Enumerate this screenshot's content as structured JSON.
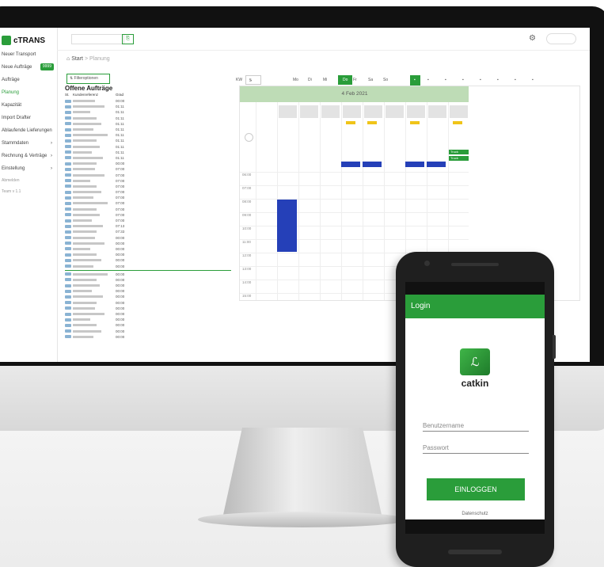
{
  "brand": {
    "name": "cTRANS"
  },
  "sidebar": {
    "items": [
      {
        "label": "Neuer Transport"
      },
      {
        "label": "Neue Aufträge",
        "badge": "9999"
      },
      {
        "label": "Aufträge"
      },
      {
        "label": "Planung"
      },
      {
        "label": "Kapazität"
      },
      {
        "label": "Import Drafter"
      },
      {
        "label": "Ablaufende Lieferungen"
      },
      {
        "label": "Stammdaten",
        "arrow": "›"
      },
      {
        "label": "Rechnung & Verträge",
        "arrow": "›"
      },
      {
        "label": "Einstellung",
        "arrow": "›"
      }
    ],
    "footer": [
      "Abmelden",
      "Team v 1.1"
    ]
  },
  "header": {
    "breadcrumb_home": "Start",
    "breadcrumb_sep": ">",
    "breadcrumb_current": "Planung"
  },
  "filter_button": "Filteroptionen",
  "orders": {
    "title": "Offene Aufträge",
    "columns": [
      "St.",
      "Kundenreferenz",
      "Grad"
    ],
    "values": [
      "00:00",
      "01:11",
      "01:11",
      "01:11",
      "01:11",
      "01:11",
      "01:11",
      "01:11",
      "01:11",
      "01:11",
      "01:11",
      "00:00",
      "07:00",
      "07:00",
      "07:00",
      "07:00",
      "07:00",
      "07:00",
      "07:00",
      "07:00",
      "07:00",
      "07:00",
      "07:13",
      "07:33",
      "00:00",
      "00:00",
      "00:00",
      "00:00",
      "00:00",
      "00:00",
      "00:00",
      "00:00",
      "00:00",
      "00:00",
      "00:00",
      "00:00",
      "00:00",
      "00:00",
      "00:00",
      "00:00",
      "00:00",
      "00:00"
    ]
  },
  "calendar": {
    "kw_label": "KW",
    "kw_value": "5",
    "days": [
      "Mo",
      "Di",
      "Mi",
      "Do",
      "Fr",
      "Sa",
      "So"
    ],
    "today": "Do",
    "trucks": [
      "1",
      "1",
      "2",
      "3",
      "4",
      "5",
      "6",
      "7"
    ],
    "date": "4 Feb 2021",
    "hours": [
      "06:00",
      "07:00",
      "08:00",
      "09:00",
      "10:00",
      "11:00",
      "12:00",
      "13:00",
      "14:00",
      "15:00",
      "16:00"
    ],
    "truck_chip": "Truck"
  },
  "login_app": {
    "title": "Login",
    "brand": "catkin",
    "username_placeholder": "Benutzername",
    "password_placeholder": "Passwort",
    "login_button": "EINLOGGEN",
    "privacy_link": "Datenschutz"
  },
  "colors": {
    "accent": "#2a9d3a",
    "event": "#2540b8"
  }
}
